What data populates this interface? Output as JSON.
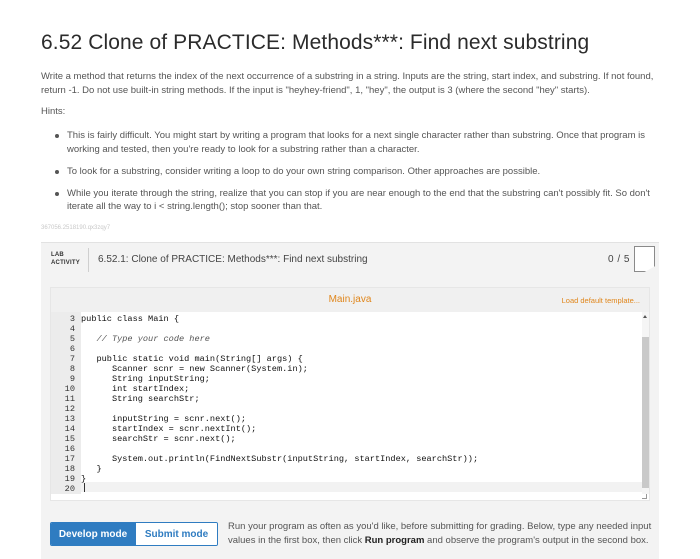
{
  "title": "6.52 Clone of PRACTICE: Methods***: Find next substring",
  "description": "Write a method that returns the index of the next occurrence of a substring in a string. Inputs are the string, start index, and substring. If not found, return -1. Do not use built-in string methods. If the input is \"heyhey-friend\", 1, \"hey\", the output is 3 (where the second \"hey\" starts).",
  "hints_label": "Hints:",
  "hints": [
    "This is fairly difficult. You might start by writing a program that looks for a next single character rather than substring. Once that program is working and tested, then you're ready to look for a substring rather than a character.",
    "To look for a substring, consider writing a loop to do your own string comparison. Other approaches are possible.",
    "While you iterate through the string, realize that you can stop if you are near enough to the end that the substring can't possibly fit. So don't iterate all the way to i < string.length(); stop sooner than that."
  ],
  "meta_id": "367056.2518190.qx3zqy7",
  "lab": {
    "badge_line1": "LAB",
    "badge_line2": "ACTIVITY",
    "name": "6.52.1: Clone of PRACTICE: Methods***: Find next substring",
    "score": "0 / 5"
  },
  "editor": {
    "filename": "Main.java",
    "load_default": "Load default template...",
    "lines": [
      {
        "n": "3",
        "code": "public class Main {"
      },
      {
        "n": "4",
        "code": ""
      },
      {
        "n": "5",
        "code": "   // Type your code here"
      },
      {
        "n": "6",
        "code": ""
      },
      {
        "n": "7",
        "code": "   public static void main(String[] args) {"
      },
      {
        "n": "8",
        "code": "      Scanner scnr = new Scanner(System.in);"
      },
      {
        "n": "9",
        "code": "      String inputString;"
      },
      {
        "n": "10",
        "code": "      int startIndex;"
      },
      {
        "n": "11",
        "code": "      String searchStr;"
      },
      {
        "n": "12",
        "code": ""
      },
      {
        "n": "13",
        "code": "      inputString = scnr.next();"
      },
      {
        "n": "14",
        "code": "      startIndex = scnr.nextInt();"
      },
      {
        "n": "15",
        "code": "      searchStr = scnr.next();"
      },
      {
        "n": "16",
        "code": ""
      },
      {
        "n": "17",
        "code": "      System.out.println(FindNextSubstr(inputString, startIndex, searchStr));"
      },
      {
        "n": "18",
        "code": "   }"
      },
      {
        "n": "19",
        "code": "}"
      },
      {
        "n": "20",
        "code": ""
      }
    ]
  },
  "modes": {
    "develop": "Develop mode",
    "submit": "Submit mode"
  },
  "run_text": {
    "before": "Run your program as often as you'd like, before submitting for grading. Below, type any needed input values in the first box, then click ",
    "bold": "Run program",
    "after": " and observe the program's output in the second box."
  },
  "colors": {
    "accent_blue": "#2f7cc1",
    "accent_orange": "#e0861b"
  }
}
